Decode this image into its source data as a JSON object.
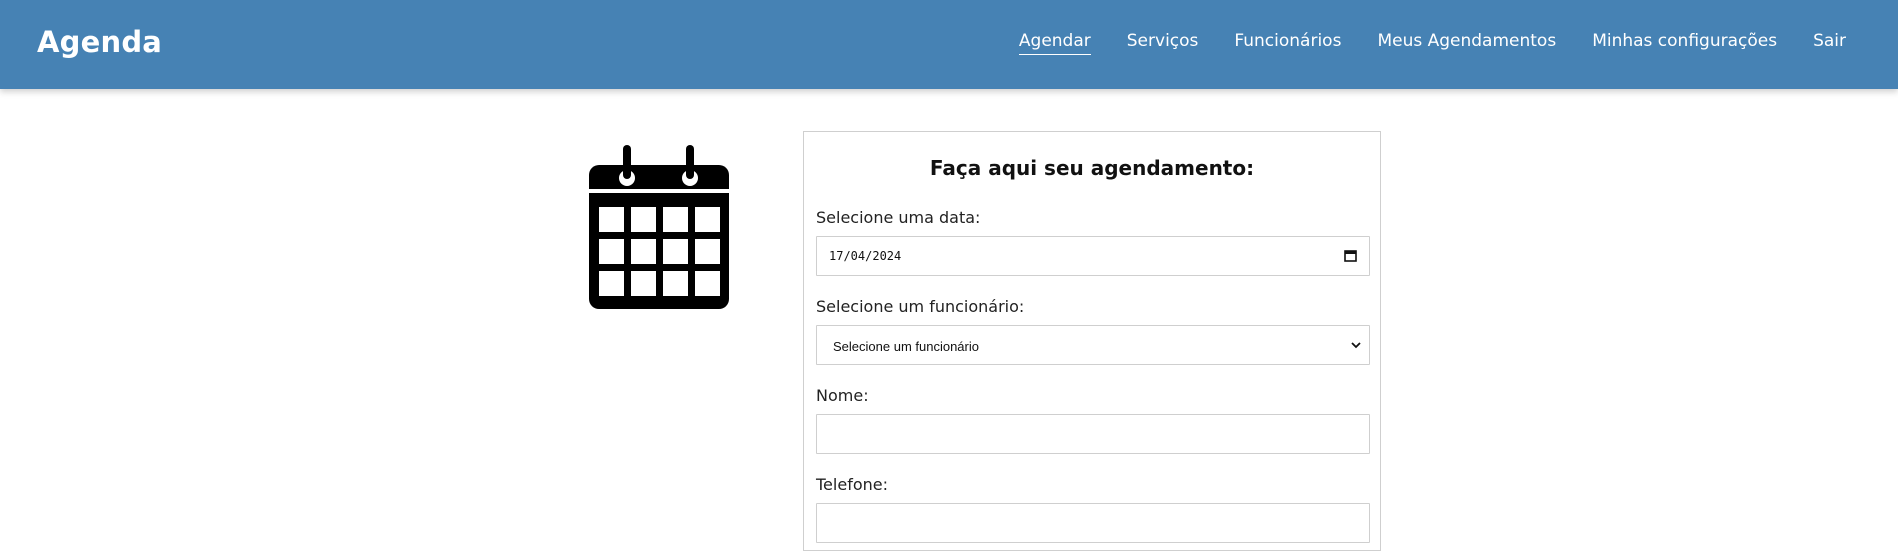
{
  "header": {
    "brand": "Agenda",
    "nav": [
      {
        "label": "Agendar",
        "active": true
      },
      {
        "label": "Serviços",
        "active": false
      },
      {
        "label": "Funcionários",
        "active": false
      },
      {
        "label": "Meus Agendamentos",
        "active": false
      },
      {
        "label": "Minhas configurações",
        "active": false
      },
      {
        "label": "Sair",
        "active": false
      }
    ],
    "background_color": "#4682b4"
  },
  "illustration": {
    "icon": "calendar-icon"
  },
  "form": {
    "title": "Faça aqui seu agendamento:",
    "date": {
      "label": "Selecione uma data:",
      "value": "17/04/2024",
      "icon": "calendar-picker-icon"
    },
    "employee": {
      "label": "Selecione um funcionário:",
      "selected": "Selecione um funcionário",
      "icon": "chevron-down-icon"
    },
    "name": {
      "label": "Nome:",
      "value": ""
    },
    "phone": {
      "label": "Telefone:",
      "value": ""
    }
  }
}
